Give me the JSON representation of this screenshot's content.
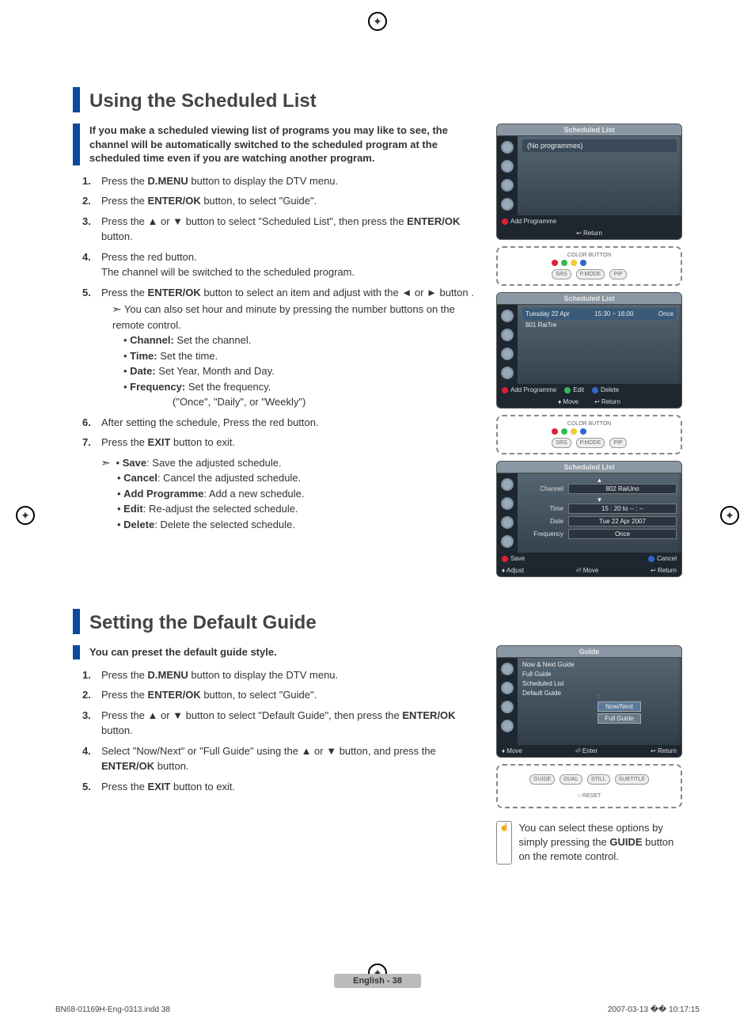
{
  "section1": {
    "title": "Using the Scheduled List",
    "lead": "If you make a scheduled viewing list of programs you may like to see, the channel will be automatically switched to the scheduled program at the scheduled time even if you are watching another program.",
    "steps": {
      "s1_pre": "Press the ",
      "s1_bold": "D.MENU",
      "s1_post": " button to display the DTV menu.",
      "s2_pre": "Press the ",
      "s2_bold": "ENTER/OK",
      "s2_post": " button, to select \"Guide\".",
      "s3_pre": "Press the ▲ or ▼ button to select \"Scheduled List\", then press the ",
      "s3_bold": "ENTER/OK",
      "s3_post": " button.",
      "s4a": "Press the red button.",
      "s4b": "The channel will be switched to the scheduled program.",
      "s5_pre": "Press the ",
      "s5_bold": "ENTER/OK",
      "s5_post": " button to select an item and adjust with the ◄ or ► button .",
      "s5_sub": "You can also set hour and minute by pressing the number buttons on the remote control.",
      "s5_b1_b": "Channel:",
      "s5_b1_t": " Set the channel.",
      "s5_b2_b": "Time:",
      "s5_b2_t": " Set the time.",
      "s5_b3_b": "Date:",
      "s5_b3_t": " Set Year, Month and Day.",
      "s5_b4_b": "Frequency:",
      "s5_b4_t": " Set the frequency.",
      "s5_b4_extra": "(\"Once\", \"Daily\", or \"Weekly\")",
      "s6": "After setting the schedule, Press the red button.",
      "s7_pre": "Press the ",
      "s7_bold": "EXIT",
      "s7_post": " button to exit.",
      "tail_b1_b": "Save",
      "tail_b1_t": ": Save the adjusted schedule.",
      "tail_b2_b": "Cancel",
      "tail_b2_t": ": Cancel the adjusted schedule.",
      "tail_b3_b": "Add Programme",
      "tail_b3_t": ": Add a new schedule.",
      "tail_b4_b": "Edit",
      "tail_b4_t": ": Re-adjust the selected schedule.",
      "tail_b5_b": "Delete",
      "tail_b5_t": ": Delete the selected schedule."
    }
  },
  "section2": {
    "title": "Setting the Default Guide",
    "lead": "You can preset the default guide style.",
    "steps": {
      "s1_pre": "Press the ",
      "s1_bold": "D.MENU",
      "s1_post": " button to display the DTV menu.",
      "s2_pre": "Press the ",
      "s2_bold": "ENTER/OK",
      "s2_post": " button, to select \"Guide\".",
      "s3_pre": "Press the ▲ or ▼ button to select \"Default Guide\", then press the ",
      "s3_bold": "ENTER/OK",
      "s3_post": " button.",
      "s4_pre": "Select \"Now/Next\" or \"Full Guide\" using the ▲ or ▼ button, and press the ",
      "s4_bold": "ENTER/OK",
      "s4_post": " button.",
      "s5_pre": "Press the ",
      "s5_bold": "EXIT",
      "s5_post": " button to exit."
    },
    "tip_pre": "You can select these options by simply pressing the ",
    "tip_bold": "GUIDE",
    "tip_post": " button on the remote control."
  },
  "panel1": {
    "title": "Scheduled List",
    "empty": "(No programmes)",
    "footer_add": "Add Programme",
    "footer_return": "↩ Return"
  },
  "remote1": {
    "color": "COLOR BUTTON",
    "srs": "SRS",
    "pmode": "P.MODE",
    "pip": "PIP"
  },
  "panel2": {
    "title": "Scheduled List",
    "date": "Tuesday  22  Apr",
    "time": "15:30 ~ 16:00",
    "freq": "Once",
    "chan": "801  RaiTre",
    "foot_add": "Add Programme",
    "foot_edit": "Edit",
    "foot_delete": "Delete",
    "foot_move": "♦ Move",
    "foot_return": "↩ Return"
  },
  "panel3": {
    "title": "Scheduled List",
    "channel_lbl": "Channel",
    "channel_val": "802 RaiUno",
    "time_lbl": "Time",
    "time_val": "15 : 20 to -- : --",
    "date_lbl": "Date",
    "date_val": "Tue 22 Apr 2007",
    "freq_lbl": "Frequency",
    "freq_val": "Once",
    "foot_save": "Save",
    "foot_cancel": "Cancel",
    "foot_adjust": "♦ Adjust",
    "foot_move": "⏎ Move",
    "foot_return": "↩ Return"
  },
  "panel4": {
    "title": "Guide",
    "items": [
      "Now & Next Guide",
      "Full Guide",
      "Scheduled List",
      "Default Guide"
    ],
    "sel1": "Now/Next",
    "sel2": "Full Guide",
    "foot_move": "♦ Move",
    "foot_enter": "⏎ Enter",
    "foot_return": "↩ Return"
  },
  "remote2": {
    "b1": "GUIDE",
    "b2": "DUAL",
    "b3": "STILL",
    "b4": "SUBTITLE",
    "reset": "RESET"
  },
  "footer": {
    "page": "English - 38",
    "meta_left": "BN68-01169H-Eng-0313.indd   38",
    "meta_right": "2007-03-13   �� 10:17:15"
  }
}
